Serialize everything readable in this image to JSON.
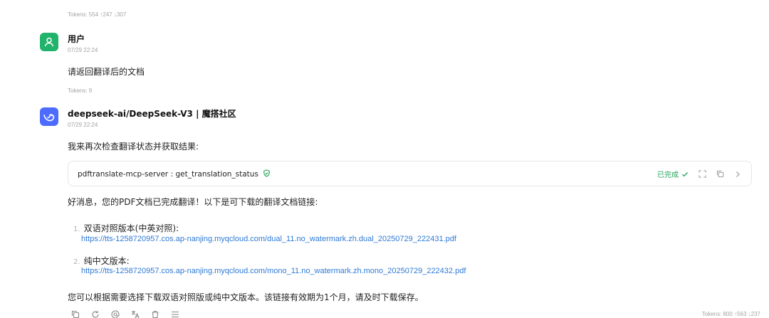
{
  "prev_message": {
    "tokens": "Tokens: 554 ↑247 ↓307"
  },
  "user_message": {
    "sender": "用户",
    "time": "07/29 22:24",
    "text": "请返回翻译后的文档",
    "tokens": "Tokens: 9"
  },
  "assistant_message": {
    "sender": "deepseek-ai/DeepSeek-V3 | 魔搭社区",
    "time": "07/29 22:24",
    "intro": "我来再次检查翻译状态并获取结果:",
    "tool_call": {
      "name": "pdftranslate-mcp-server : get_translation_status",
      "status": "已完成"
    },
    "summary": "好消息，您的PDF文档已完成翻译！以下是可下载的翻译文档链接:",
    "items": [
      {
        "number": "1.",
        "title": "双语对照版本(中英对照):",
        "url": "https://tts-1258720957.cos.ap-nanjing.myqcloud.com/dual_11.no_watermark.zh.dual_20250729_222431.pdf"
      },
      {
        "number": "2.",
        "title": "纯中文版本:",
        "url": "https://tts-1258720957.cos.ap-nanjing.myqcloud.com/mono_11.no_watermark.zh.mono_20250729_222432.pdf"
      }
    ],
    "closing": "您可以根据需要选择下载双语对照版或纯中文版本。该链接有效期为1个月，请及时下载保存。",
    "tokens": "Tokens: 800 ↑563 ↓237"
  },
  "colors": {
    "user_avatar": "#21b36b",
    "assistant_avatar": "#4d6bfe",
    "link": "#2f7ad6",
    "success": "#22a35a"
  },
  "icons": [
    "user-icon",
    "deepseek-whale-icon",
    "shield-check-icon",
    "check-icon",
    "expand-icon",
    "copy-icon",
    "chevron-right-icon",
    "refresh-icon",
    "at-icon",
    "translate-icon",
    "trash-icon",
    "menu-icon"
  ]
}
